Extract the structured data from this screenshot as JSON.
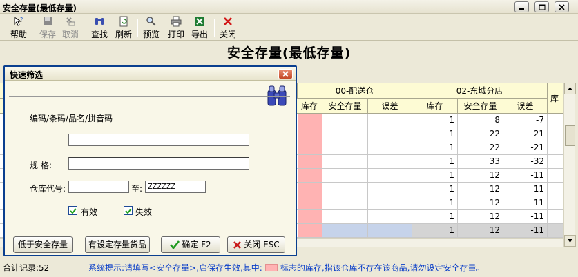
{
  "window": {
    "title": "安全存量(最低存量)"
  },
  "toolbar": {
    "items": [
      {
        "label": "帮助",
        "icon": "help-icon",
        "enabled": true
      },
      {
        "label": "保存",
        "icon": "save-icon",
        "enabled": false
      },
      {
        "label": "取消",
        "icon": "cancel-icon",
        "enabled": false
      },
      {
        "label": "查找",
        "icon": "binoculars-icon",
        "enabled": true
      },
      {
        "label": "刷新",
        "icon": "refresh-icon",
        "enabled": true
      },
      {
        "label": "预览",
        "icon": "preview-icon",
        "enabled": true
      },
      {
        "label": "打印",
        "icon": "printer-icon",
        "enabled": true
      },
      {
        "label": "导出",
        "icon": "excel-icon",
        "enabled": true
      },
      {
        "label": "关闭",
        "icon": "close-icon",
        "enabled": true
      }
    ]
  },
  "report": {
    "title": "安全存量(最低存量)"
  },
  "grid": {
    "groups": [
      {
        "name": "00-配送仓",
        "columns": [
          "库存",
          "安全存量",
          "误差"
        ]
      },
      {
        "name": "02-东城分店",
        "columns": [
          "库存",
          "安全存量",
          "误差"
        ]
      },
      {
        "name": "",
        "columns": [
          "库存"
        ]
      }
    ],
    "partial_column_label": "库存",
    "rows": [
      {
        "stock2": "1",
        "safety2": "8",
        "diff2": "-7"
      },
      {
        "stock2": "1",
        "safety2": "22",
        "diff2": "-21"
      },
      {
        "stock2": "1",
        "safety2": "22",
        "diff2": "-21"
      },
      {
        "stock2": "1",
        "safety2": "33",
        "diff2": "-32"
      },
      {
        "stock2": "1",
        "safety2": "12",
        "diff2": "-11"
      },
      {
        "stock2": "1",
        "safety2": "12",
        "diff2": "-11"
      },
      {
        "stock2": "1",
        "safety2": "12",
        "diff2": "-11"
      },
      {
        "stock2": "1",
        "safety2": "12",
        "diff2": "-11"
      },
      {
        "stock2": "1",
        "safety2": "12",
        "diff2": "-11"
      }
    ],
    "colors": {
      "missing_warehouse": "#ffb3b3",
      "header_bg": "#fdfbd4",
      "selected_row": "#d4d4d4"
    }
  },
  "status": {
    "count": "合计记录:52",
    "hint_pre": "系统提示:请填写<安全存量>,启保存生效,其中:",
    "hint_post": "标志的库存,指该仓库不存在该商品,请勿设定安全存量。"
  },
  "dialog": {
    "title": "快速筛选",
    "code_label": "编码/条码/品名/拼音码",
    "code_value": "",
    "spec_label": "规      格:",
    "spec_value": "",
    "warehouse_label": "仓库代号:",
    "warehouse_from": "",
    "to_label": "至:",
    "warehouse_to": "ZZZZZZ",
    "valid_label": "有效",
    "valid_checked": true,
    "invalid_label": "失效",
    "invalid_checked": true,
    "buttons": {
      "below_safety": "低于安全存量",
      "has_safety": "有设定存量货品",
      "ok": "确定 F2",
      "close": "关闭 ESC"
    }
  }
}
